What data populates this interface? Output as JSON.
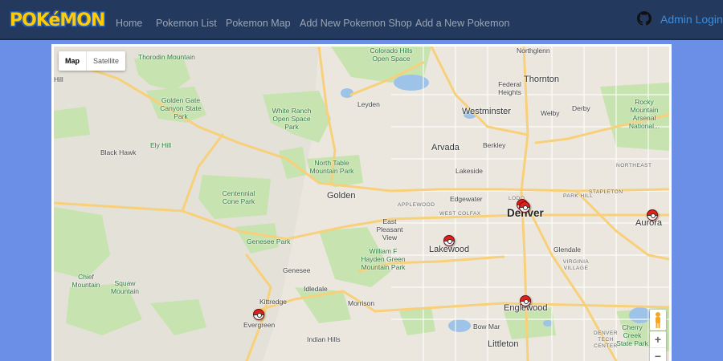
{
  "brand": {
    "logo_text": "POKéMON"
  },
  "nav": {
    "items": [
      {
        "label": "Home"
      },
      {
        "label": "Pokemon List"
      },
      {
        "label": "Pokemon Map"
      },
      {
        "label": "Add New Pokemon Shop"
      },
      {
        "label": "Add a New Pokemon"
      }
    ],
    "admin_login": "Admin Login",
    "github_icon": "github-icon"
  },
  "map": {
    "type_control": {
      "map_label": "Map",
      "satellite_label": "Satellite",
      "selected": "Map"
    },
    "zoom": {
      "in_label": "+",
      "out_label": "−"
    },
    "places": {
      "thorodin": "Thorodin Mountain",
      "golden_gate": "Golden Gate Canyon State Park",
      "white_ranch": "White Ranch Open Space Park",
      "colorado_hills": "Colorado Hills Open Space",
      "northglenn": "Northglenn",
      "thornton": "Thornton",
      "federal_heights": "Federal Heights",
      "westminster": "Westminster",
      "welby": "Welby",
      "derby": "Derby",
      "rocky_mountain": "Rocky Mountain Arsenal National...",
      "leyden": "Leyden",
      "black_hawk": "Black Hawk",
      "ely_hill": "Ely Hill",
      "arvada": "Arvada",
      "berkley": "Berkley",
      "north_table": "North Table Mountain Park",
      "lakeside": "Lakeside",
      "northeast": "NORTHEAST",
      "stapleton": "STAPLETON",
      "park_hill": "PARK HILL",
      "lodo": "LODO",
      "centennial_cone": "Centennial Cone Park",
      "golden": "Golden",
      "edgewater": "Edgewater",
      "applewood": "APPLEWOOD",
      "denver": "Denver",
      "aurora": "Aurora",
      "east_pleasant_view": "East Pleasant View",
      "west_colfax": "WEST COLFAX",
      "genesee_park": "Genesee Park",
      "genesee": "Genesee",
      "lakewood": "Lakewood",
      "glendale": "Glendale",
      "virginia_village": "VIRGINIA VILLAGE",
      "william_hayden": "William F Hayden Green Mountain Park",
      "chief_mountain": "Chief Mountain",
      "squaw_mountain": "Squaw Mountain",
      "kittredge": "Kittredge",
      "idledale": "Idledale",
      "evergreen": "Evergreen",
      "morrison": "Morrison",
      "englewood": "Englewood",
      "bow_mar": "Bow Mar",
      "indian_hills": "Indian Hills",
      "littleton": "Littleton",
      "denver_tech": "DENVER TECH CENTER",
      "cherry_creek": "Cherry Creek State Park",
      "hill": "Hill"
    },
    "markers": [
      "pokemon-marker",
      "pokemon-marker",
      "pokemon-marker",
      "pokemon-marker",
      "pokemon-marker",
      "pokemon-marker"
    ],
    "colors": {
      "park": "#c7e3b0",
      "road": "#f8d07a",
      "water": "#9ec3e8",
      "land": "#ebe7df"
    }
  }
}
